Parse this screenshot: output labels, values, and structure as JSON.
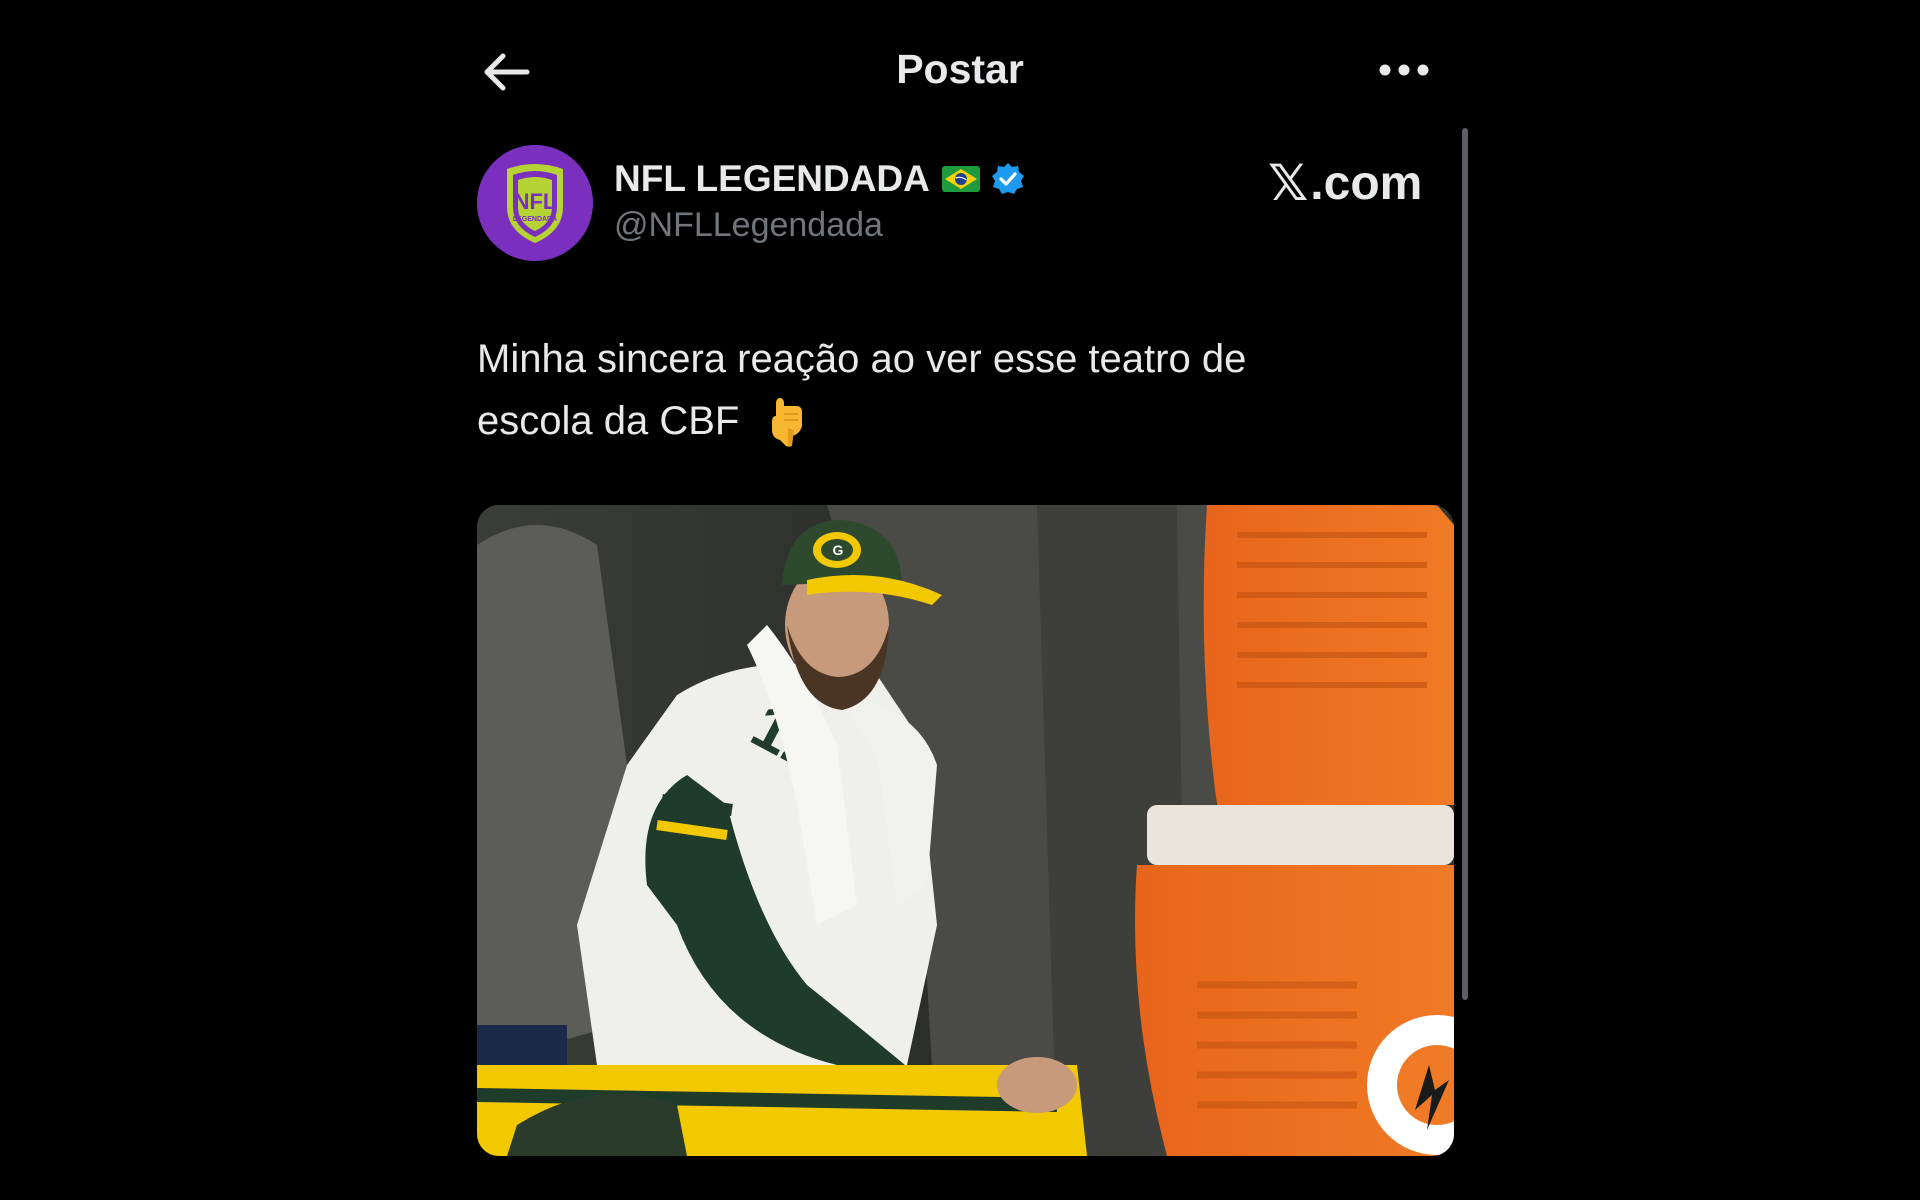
{
  "header": {
    "title": "Postar",
    "back_icon": "arrow-left-icon",
    "more_icon": "more-horizontal-icon"
  },
  "tweet": {
    "author": {
      "name": "NFL LEGENDADA",
      "handle": "@NFLLegendada",
      "flag": "brazil-flag-icon",
      "verified": true,
      "avatar_text": "NFL",
      "avatar_subtext": "LEGENDADA"
    },
    "watermark": {
      "mark": "𝕏",
      "suffix": ".com"
    },
    "text_line_1": "Minha sincera reação ao ver esse teatro de",
    "text_line_2": "escola da CBF",
    "emoji": "backhand-index-pointing-down-emoji",
    "media": {
      "jersey_number": "12"
    }
  },
  "colors": {
    "background": "#000000",
    "text": "#e7e9ea",
    "secondary_text": "#71767b",
    "verified": "#1d9bf0",
    "avatar_purple": "#7b2fbe",
    "avatar_shield": "#b5d334"
  }
}
